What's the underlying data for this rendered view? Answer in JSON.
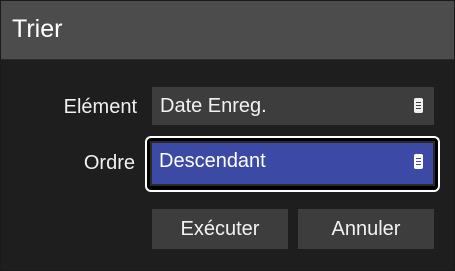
{
  "dialog": {
    "title": "Trier"
  },
  "element_row": {
    "label": "Elément",
    "value": "Date Enreg.",
    "icon": "menu-icon"
  },
  "order_row": {
    "label": "Ordre",
    "value": "Descendant",
    "icon": "menu-icon",
    "selected": true
  },
  "buttons": {
    "execute_label": "Exécuter",
    "cancel_label": "Annuler"
  },
  "colors": {
    "background": "#1e1e1e",
    "titlebar": "#4c4c4c",
    "field": "#3d3d3d",
    "selected_field": "#3c4aa6",
    "focus_ring": "#ffffff"
  }
}
